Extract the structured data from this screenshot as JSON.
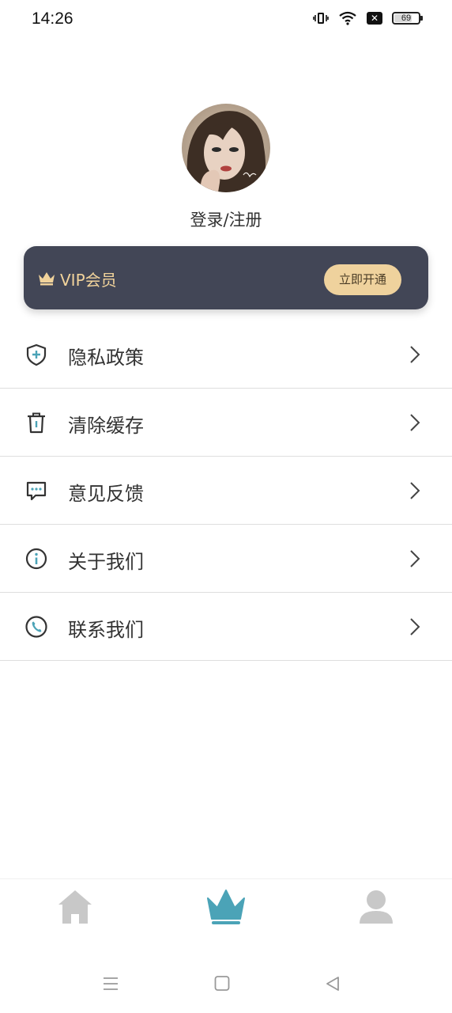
{
  "status_bar": {
    "time": "14:26",
    "battery": "69",
    "battery_level": 0.69
  },
  "profile": {
    "login_label": "登录/注册"
  },
  "vip": {
    "title": "VIP会员",
    "button_label": "立即开通",
    "colors": {
      "card": "#424656",
      "gold": "#f1d39b",
      "button": "#efd29d"
    }
  },
  "menu": {
    "items": [
      {
        "label": "隐私政策",
        "icon": "shield-icon"
      },
      {
        "label": "清除缓存",
        "icon": "trash-icon"
      },
      {
        "label": "意见反馈",
        "icon": "message-icon"
      },
      {
        "label": "关于我们",
        "icon": "info-icon"
      },
      {
        "label": "联系我们",
        "icon": "phone-icon"
      }
    ]
  },
  "tab_bar": {
    "tabs": [
      {
        "icon": "home-icon",
        "active": false
      },
      {
        "icon": "crown-icon",
        "active": true
      },
      {
        "icon": "user-icon",
        "active": false
      }
    ],
    "active_color": "#4ba3b7",
    "inactive_color": "#c8c8c8"
  },
  "system_nav": {
    "buttons": [
      "menu-icon",
      "home-square-icon",
      "back-icon"
    ]
  }
}
